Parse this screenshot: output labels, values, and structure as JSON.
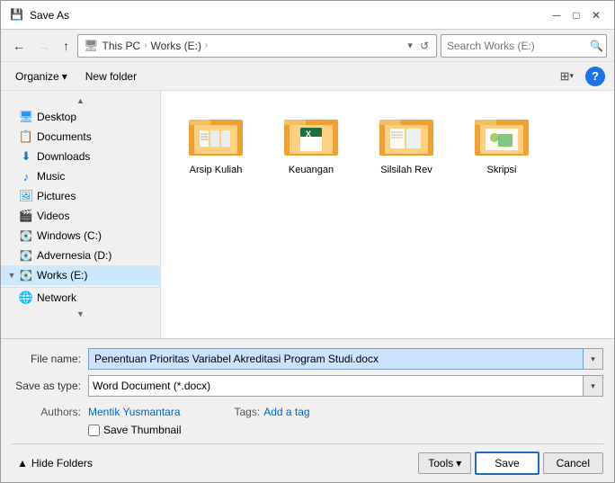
{
  "titlebar": {
    "title": "Save As",
    "icon": "💾"
  },
  "toolbar": {
    "back_label": "←",
    "forward_label": "→",
    "up_label": "↑",
    "breadcrumb": [
      "This PC",
      "Works (E:)"
    ],
    "search_placeholder": "Search Works (E:)"
  },
  "second_toolbar": {
    "organize_label": "Organize",
    "new_folder_label": "New folder"
  },
  "sidebar": {
    "items": [
      {
        "id": "desktop",
        "label": "Desktop",
        "icon": "🖥",
        "indent": 1,
        "expanded": false
      },
      {
        "id": "documents",
        "label": "Documents",
        "icon": "📄",
        "indent": 1,
        "expanded": false
      },
      {
        "id": "downloads",
        "label": "Downloads",
        "icon": "⬇",
        "indent": 1,
        "expanded": false
      },
      {
        "id": "music",
        "label": "Music",
        "icon": "♪",
        "indent": 1,
        "expanded": false
      },
      {
        "id": "pictures",
        "label": "Pictures",
        "icon": "🖼",
        "indent": 1,
        "expanded": false
      },
      {
        "id": "videos",
        "label": "Videos",
        "icon": "🎬",
        "indent": 1,
        "expanded": false
      },
      {
        "id": "windows",
        "label": "Windows (C:)",
        "icon": "💽",
        "indent": 1,
        "expanded": false
      },
      {
        "id": "advernesia",
        "label": "Advernesia (D:)",
        "icon": "💽",
        "indent": 1,
        "expanded": false
      },
      {
        "id": "works",
        "label": "Works (E:)",
        "icon": "💽",
        "indent": 1,
        "expanded": true,
        "selected": true
      },
      {
        "id": "network",
        "label": "Network",
        "icon": "🌐",
        "indent": 0,
        "expanded": false
      }
    ]
  },
  "files": [
    {
      "id": "arsip",
      "name": "Arsip Kuliah",
      "type": "folder"
    },
    {
      "id": "keuangan",
      "name": "Keuangan",
      "type": "folder-excel"
    },
    {
      "id": "silsilah",
      "name": "Silsilah Rev",
      "type": "folder-doc"
    },
    {
      "id": "skripsi",
      "name": "Skripsi",
      "type": "folder-image"
    }
  ],
  "form": {
    "filename_label": "File name:",
    "filename_value": "Penentuan Prioritas Variabel Akreditasi Program Studi.docx",
    "savetype_label": "Save as type:",
    "savetype_value": "Word Document (*.docx)",
    "authors_label": "Authors:",
    "authors_value": "Mentik Yusmantara",
    "tags_label": "Tags:",
    "add_tag_label": "Add a tag",
    "thumbnail_label": "Save Thumbnail",
    "hide_folders_label": "Hide Folders",
    "tools_label": "Tools",
    "save_label": "Save",
    "cancel_label": "Cancel"
  }
}
